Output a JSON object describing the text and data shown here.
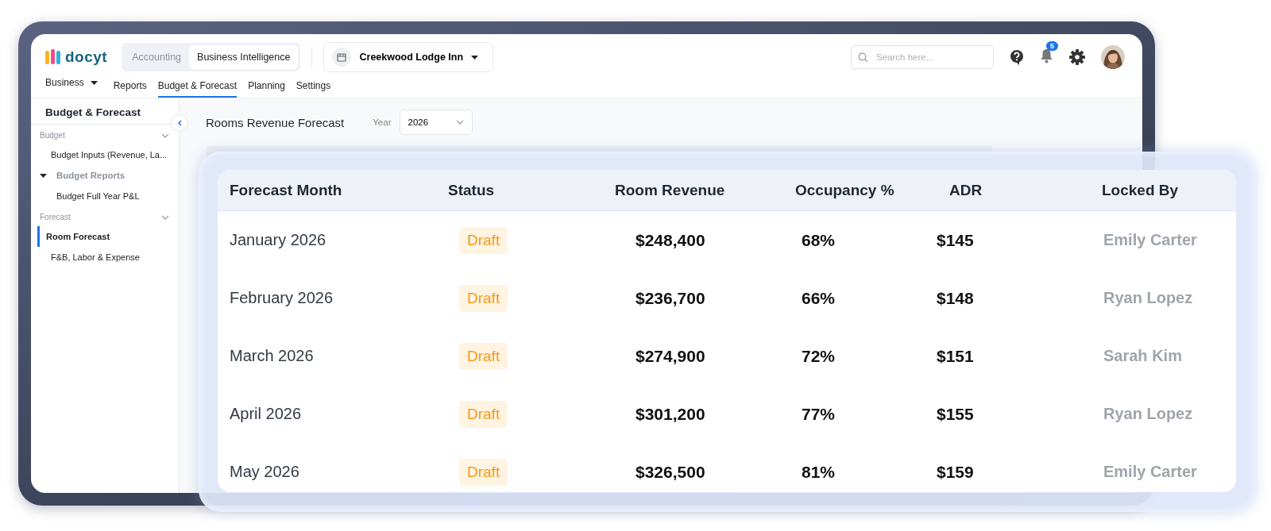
{
  "app": {
    "logo": "docyt",
    "modules": [
      {
        "label": "Accounting",
        "selected": false
      },
      {
        "label": "Business Intelligence",
        "selected": true
      }
    ],
    "business": "Creekwood Lodge Inn",
    "search": {
      "placeholder": "Search here..."
    },
    "notifications": "5"
  },
  "nav": [
    {
      "label": "Business",
      "kind": "dropdown",
      "selected": false
    },
    {
      "label": "Reports",
      "kind": "link",
      "selected": false
    },
    {
      "label": "Budget & Forecast",
      "kind": "link",
      "selected": true
    },
    {
      "label": "Planning",
      "kind": "link",
      "selected": false
    },
    {
      "label": "Settings",
      "kind": "link",
      "selected": false
    }
  ],
  "sidebar": {
    "title": "Budget & Forecast",
    "sections": [
      {
        "label": "Budget",
        "expanded": true,
        "items": [
          {
            "label": "Budget Inputs (Revenue, La...",
            "kind": "page",
            "selected": false
          },
          {
            "label": "Budget Reports",
            "kind": "group",
            "expanded": true,
            "children": [
              {
                "label": "Budget Full Year P&L",
                "selected": false
              }
            ]
          }
        ]
      },
      {
        "label": "Forecast",
        "expanded": true,
        "items": [
          {
            "label": "Room Forecast",
            "kind": "page",
            "selected": true
          },
          {
            "label": "F&B, Labor & Expense",
            "kind": "page",
            "selected": false
          }
        ]
      }
    ]
  },
  "page": {
    "title": "Rooms Revenue Forecast",
    "year_label": "Year",
    "year": "2026"
  },
  "table": {
    "columns": [
      "Forecast Month",
      "Status",
      "Room Revenue",
      "Occupancy %",
      "ADR",
      "Locked By"
    ],
    "rows": [
      {
        "month": "January 2026",
        "status": "Draft",
        "revenue": "$248,400",
        "occupancy": "68%",
        "adr": "$145",
        "locked_by": "Emily Carter"
      },
      {
        "month": "February 2026",
        "status": "Draft",
        "revenue": "$236,700",
        "occupancy": "66%",
        "adr": "$148",
        "locked_by": "Ryan Lopez"
      },
      {
        "month": "March 2026",
        "status": "Draft",
        "revenue": "$274,900",
        "occupancy": "72%",
        "adr": "$151",
        "locked_by": "Sarah Kim"
      },
      {
        "month": "April 2026",
        "status": "Draft",
        "revenue": "$301,200",
        "occupancy": "77%",
        "adr": "$155",
        "locked_by": "Ryan Lopez"
      },
      {
        "month": "May 2026",
        "status": "Draft",
        "revenue": "$326,500",
        "occupancy": "81%",
        "adr": "$159",
        "locked_by": "Emily Carter"
      }
    ]
  }
}
